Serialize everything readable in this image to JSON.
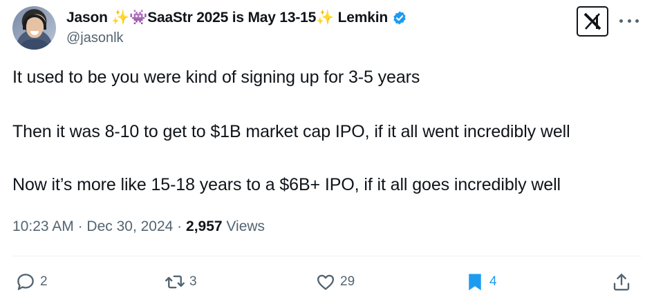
{
  "author": {
    "display_name": "Jason ✨👾SaaStr 2025 is May 13-15✨ Lemkin",
    "handle": "@jasonlk",
    "verified": true
  },
  "tweet": {
    "lines": [
      "It used to be you were kind of signing up for 3-5 years",
      "Then it was 8-10 to get to $1B market cap IPO, if it all went incredibly well",
      "Now it’s more like 15-18 years to a $6B+ IPO, if it all goes incredibly well"
    ],
    "time": "10:23 AM",
    "date": "Dec 30, 2024",
    "views_count": "2,957",
    "views_label": "Views",
    "separator": " · "
  },
  "actions": {
    "replies": "2",
    "reposts": "3",
    "likes": "29",
    "bookmarks": "4"
  },
  "icons": {
    "brand": "x-logo-icon",
    "more": "more-options-icon",
    "reply": "reply-icon",
    "repost": "repost-icon",
    "like": "heart-icon",
    "bookmark": "bookmark-icon",
    "share": "share-icon",
    "verified": "verified-badge-icon"
  },
  "colors": {
    "text": "#0f1419",
    "secondary": "#536471",
    "accent": "#1d9bf0",
    "divider": "#eff3f4"
  }
}
